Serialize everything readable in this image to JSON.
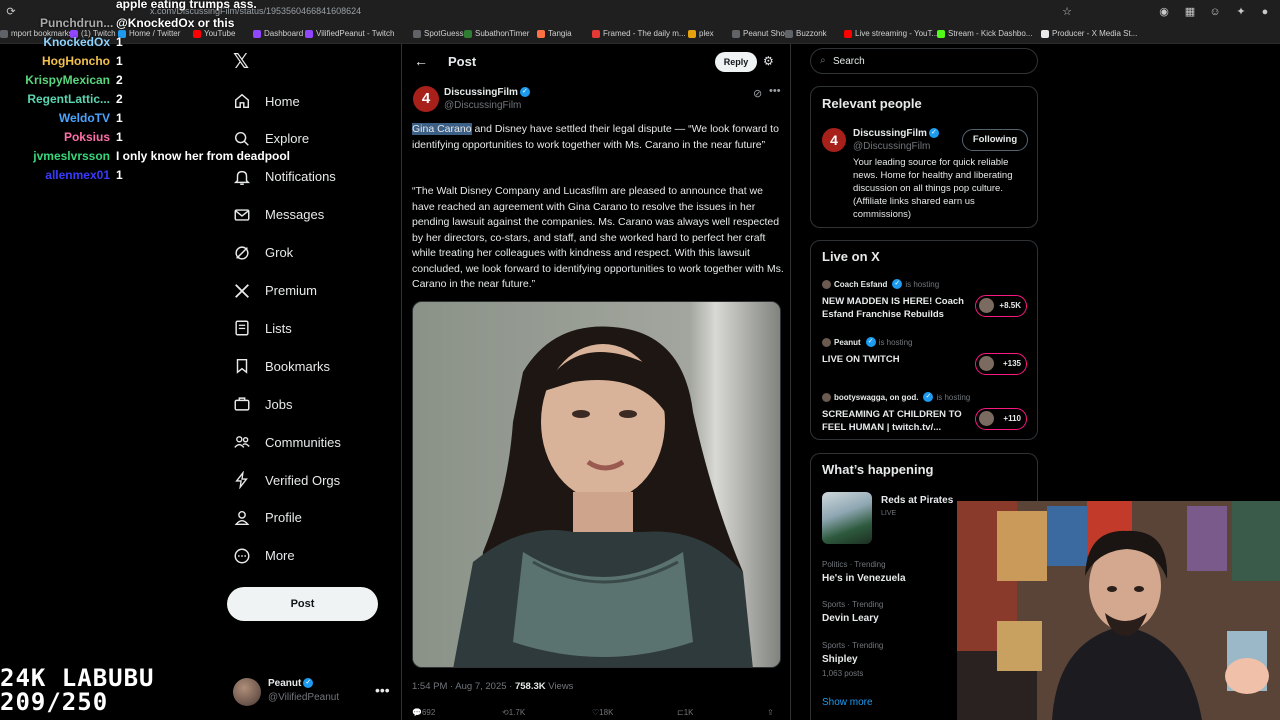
{
  "browser": {
    "url": "x.com/DiscussingFilm/status/1953560466841608624",
    "bookmarks": [
      {
        "label": "mport bookmarks",
        "color": "#5f6368"
      },
      {
        "label": "(1) Twitch",
        "color": "#9146ff"
      },
      {
        "label": "Home / Twitter",
        "color": "#1d9bf0"
      },
      {
        "label": "YouTube",
        "color": "#ff0000"
      },
      {
        "label": "Dashboard",
        "color": "#9146ff"
      },
      {
        "label": "VilifiedPeanut - Twitch",
        "color": "#9146ff"
      },
      {
        "label": "SpotGuessr",
        "color": "#5f6368"
      },
      {
        "label": "SubathonTimer",
        "color": "#2e7d32"
      },
      {
        "label": "Tangia",
        "color": "#ff7043"
      },
      {
        "label": "Framed - The daily m...",
        "color": "#e53935"
      },
      {
        "label": "plex",
        "color": "#e5a00d"
      },
      {
        "label": "Peanut Shop",
        "color": "#5f6368"
      },
      {
        "label": "Buzzonk",
        "color": "#5f6368"
      },
      {
        "label": "Live streaming - YouT...",
        "color": "#ff0000"
      },
      {
        "label": "Stream - Kick Dashbo...",
        "color": "#53fc18"
      },
      {
        "label": "Producer - X Media St...",
        "color": "#e7e9ea"
      }
    ]
  },
  "stream_chat": {
    "top_lines": [
      {
        "name": "Punchdrun...",
        "message": "apple eating trumps ass."
      },
      {
        "name": "",
        "message": "@KnockedOx or this"
      }
    ],
    "rows": [
      {
        "name": "KnockedOx",
        "color": "#8fd3ff",
        "message": "1"
      },
      {
        "name": "HogHoncho",
        "color": "#f2c14e",
        "message": "1"
      },
      {
        "name": "KrispyMexican",
        "color": "#5ad67d",
        "message": "2"
      },
      {
        "name": "RegentLattic...",
        "color": "#5ad6b0",
        "message": "2"
      },
      {
        "name": "WeldoTV",
        "color": "#4aa3ff",
        "message": "1"
      },
      {
        "name": "Poksius",
        "color": "#ff6fa8",
        "message": "1"
      },
      {
        "name": "jvmeslvrsson",
        "color": "#37d67a",
        "message": "I only know her from deadpool"
      },
      {
        "name": "allenmex01",
        "color": "#3a3aff",
        "message": "1"
      }
    ]
  },
  "overlay_counter": {
    "line1": "24K LABUBU",
    "line2": "209/250"
  },
  "nav": {
    "items": [
      {
        "label": "Home",
        "icon": "home-icon"
      },
      {
        "label": "Explore",
        "icon": "search-icon"
      },
      {
        "label": "Notifications",
        "icon": "bell-icon"
      },
      {
        "label": "Messages",
        "icon": "envelope-icon"
      },
      {
        "label": "Grok",
        "icon": "grok-icon"
      },
      {
        "label": "Premium",
        "icon": "x-logo-icon"
      },
      {
        "label": "Lists",
        "icon": "list-icon"
      },
      {
        "label": "Bookmarks",
        "icon": "bookmark-icon"
      },
      {
        "label": "Jobs",
        "icon": "briefcase-icon"
      },
      {
        "label": "Communities",
        "icon": "people-icon"
      },
      {
        "label": "Verified Orgs",
        "icon": "lightning-icon"
      },
      {
        "label": "Profile",
        "icon": "person-icon"
      },
      {
        "label": "More",
        "icon": "more-circle-icon"
      }
    ],
    "post_label": "Post",
    "account": {
      "name": "Peanut",
      "handle": "@VilifiedPeanut"
    }
  },
  "post": {
    "header_title": "Post",
    "reply_label": "Reply",
    "author_name": "DiscussingFilm",
    "author_handle": "@DiscussingFilm",
    "text_highlight": "Gina Carano",
    "text_p1_rest": " and Disney have settled their legal dispute — “We look forward to identifying opportunities to work together with Ms. Carano in the near future”",
    "text_p2": "“The Walt Disney Company and Lucasfilm are pleased to announce that we have reached an agreement with Gina Carano to resolve the issues in her pending lawsuit against the companies.  Ms. Carano was always well respected by her directors, co-stars, and staff, and she worked hard to perfect her craft while treating her colleagues with kindness and respect.  With this lawsuit concluded, we look forward to identifying opportunities to work together with Ms. Carano in the near future.”",
    "timestamp": "1:54 PM · Aug 7, 2025 · ",
    "views_count": "758.3K",
    "views_label": " Views",
    "action_counts": [
      "692",
      "1.7K",
      "18K",
      "1K"
    ]
  },
  "sidebar": {
    "search_placeholder": "Search",
    "relevant_people": {
      "title": "Relevant people",
      "name": "DiscussingFilm",
      "handle": "@DiscussingFilm",
      "follow_label": "Following",
      "bio": "Your leading source for quick reliable news. Home for healthy and liberating discussion on all things pop culture. (Affiliate links shared earn us commissions)"
    },
    "live_on_x": {
      "title": "Live on X",
      "items": [
        {
          "host": "Coach Esfand",
          "hosting": "is hosting",
          "title": "NEW MADDEN IS HERE! Coach Esfand Franchise Rebuilds",
          "count": "+8.5K"
        },
        {
          "host": "Peanut",
          "hosting": "is hosting",
          "title": "LIVE ON TWITCH",
          "count": "+135"
        },
        {
          "host": "bootyswagga, on god.",
          "hosting": "is hosting",
          "title": "SCREAMING AT CHILDREN TO FEEL HUMAN | twitch.tv/...",
          "count": "+110"
        }
      ]
    },
    "whats_happening": {
      "title": "What’s happening",
      "featured": {
        "name": "Reds at Pirates",
        "status": "LIVE"
      },
      "trends": [
        {
          "category": "Politics · Trending",
          "name": "He's in Venezuela",
          "count": ""
        },
        {
          "category": "Sports · Trending",
          "name": "Devin Leary",
          "count": ""
        },
        {
          "category": "Sports · Trending",
          "name": "Shipley",
          "count": "1,063 posts"
        }
      ],
      "show_more": "Show more"
    }
  }
}
